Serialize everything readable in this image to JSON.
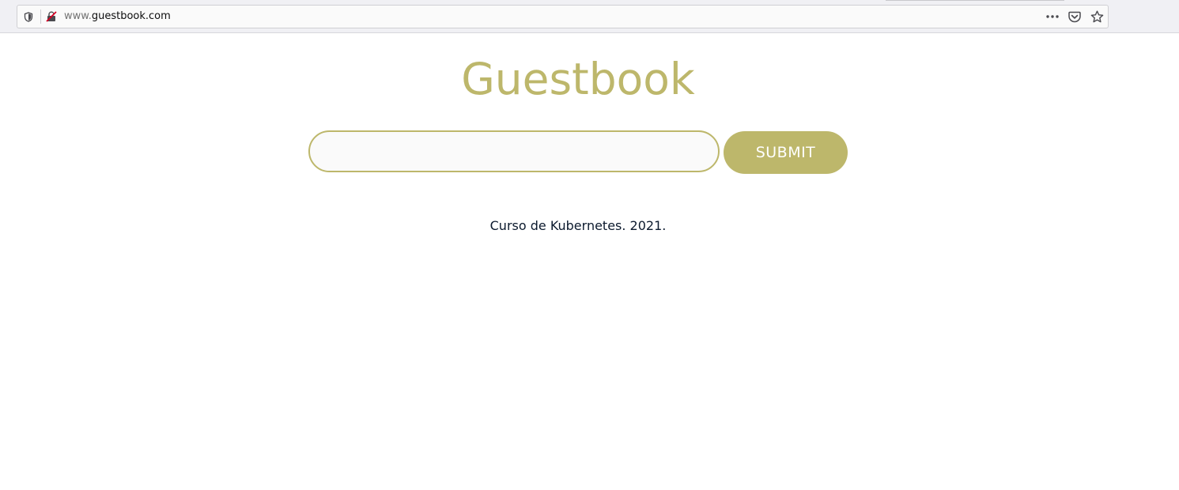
{
  "browser": {
    "url_prefix": "www.",
    "url_domain": "guestbook.com",
    "icons": {
      "tracking": "shield-icon",
      "connection": "insecure-connection-icon",
      "page_actions": "more-dots-icon",
      "pocket": "pocket-icon",
      "bookmark": "star-icon"
    }
  },
  "page": {
    "title": "Guestbook",
    "entry_value": "",
    "submit_label": "SUBMIT",
    "footer": "Curso de Kubernetes. 2021."
  },
  "colors": {
    "accent": "#bdb76b",
    "footer_text": "#0c1a2e",
    "input_bg": "#fafafa"
  }
}
